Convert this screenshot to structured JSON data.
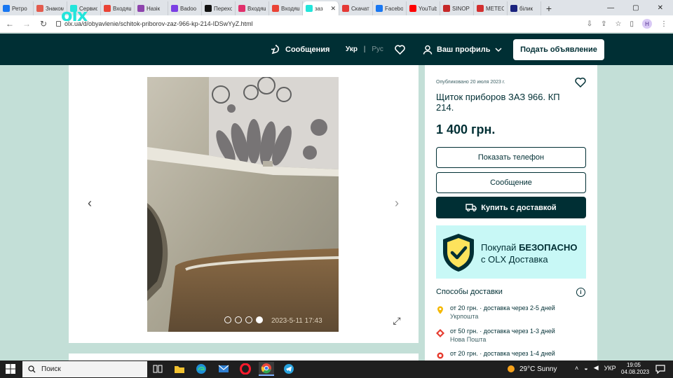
{
  "browser": {
    "tabs": [
      {
        "label": "Ретро",
        "color": "#1877f2"
      },
      {
        "label": "Знаком",
        "color": "#e35b4e"
      },
      {
        "label": "Сервис",
        "color": "#23e5db"
      },
      {
        "label": "Входящ",
        "color": "#ea4335"
      },
      {
        "label": "Назік",
        "color": "#8e44ad"
      },
      {
        "label": "Badoo",
        "color": "#7b3fe4"
      },
      {
        "label": "Перехо",
        "color": "#111111"
      },
      {
        "label": "Входящ",
        "color": "#e1306c"
      },
      {
        "label": "Входящ",
        "color": "#ea4335"
      },
      {
        "label": "заз",
        "color": "#23e5db"
      },
      {
        "label": "Скачать",
        "color": "#e53935"
      },
      {
        "label": "Facebo",
        "color": "#1877f2"
      },
      {
        "label": "YouTub",
        "color": "#ff0000"
      },
      {
        "label": "SINOP",
        "color": "#c62828"
      },
      {
        "label": "METEO",
        "color": "#d32f2f"
      },
      {
        "label": "білик",
        "color": "#1a237e"
      }
    ],
    "active_tab_index": 9,
    "new_tab_label": "+",
    "url": "olx.ua/d/obyavlenie/schitok-priborov-zaz-966-kp-214-IDSwYyZ.html",
    "profile_initial": "Н",
    "window_controls": [
      "—",
      "▢",
      "✕"
    ]
  },
  "header": {
    "logo": "olx",
    "messages_label": "Сообщения",
    "lang_active": "Укр",
    "lang_separator": "|",
    "lang_other": "Рус",
    "profile_label": "Ваш профиль",
    "post_ad_label": "Подать объявление"
  },
  "gallery": {
    "prev_arrow": "‹",
    "next_arrow": "›",
    "photo_count": 4,
    "current_photo": 4,
    "timestamp": "2023-5-11 17:43",
    "expand_icon": "⤢"
  },
  "listing": {
    "published": "Опубликовано 20 июля 2023 г.",
    "title": "Щиток приборов ЗАЗ 966. КП 214.",
    "price": "1 400 грн.",
    "show_phone_label": "Показать телефон",
    "message_label": "Сообщение",
    "buy_delivery_label": "Купить с доставкой",
    "promo_line1_prefix": "Покупай ",
    "promo_line1_bold": "БЕЗОПАСНО",
    "promo_line2": "с OLX Доставка",
    "delivery_heading": "Способы доставки",
    "info_icon": "i",
    "delivery_options": [
      {
        "main": "от 20 грн. · доставка через 2-5 дней",
        "sub": "Укрпошта",
        "color": "#f5b800"
      },
      {
        "main": "от 50 грн. · доставка через 1-3 дней",
        "sub": "Нова Пошта",
        "color": "#e63b2e"
      },
      {
        "main": "от 20 грн. · доставка через 1-4 дней",
        "sub": "",
        "color": "#e63b2e"
      }
    ]
  },
  "taskbar": {
    "search_placeholder": "Поиск",
    "weather": "29°C  Sunny",
    "lang": "УКР",
    "time": "19:05",
    "date": "04.08.2023"
  }
}
